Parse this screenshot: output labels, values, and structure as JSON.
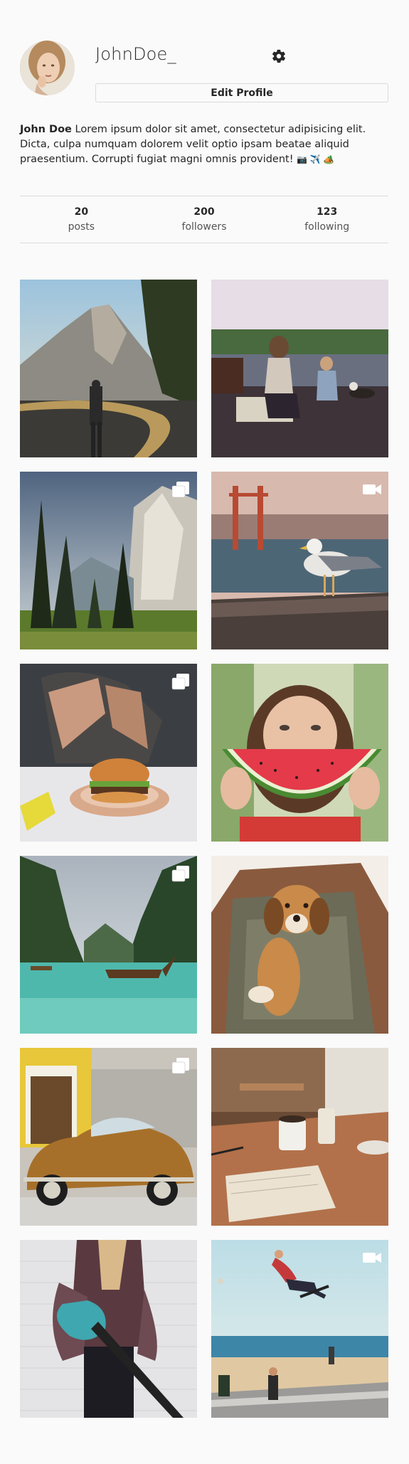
{
  "profile": {
    "username": "JohnDoe_",
    "edit_button": "Edit Profile",
    "bio_name": "John Doe",
    "bio_text": " Lorem ipsum dolor sit amet, consectetur adipisicing elit. Dicta, culpa numquam dolorem velit optio ipsam beatae aliquid praesentium. Corrupti fugiat magni omnis provident! ",
    "bio_emojis": "📷 ✈️ 🏕️",
    "avatar_icon": "profile-photo-woman"
  },
  "icons": {
    "settings": "gear-icon",
    "multiple": "multiple-images-icon",
    "video": "video-icon"
  },
  "stats": [
    {
      "count": "20",
      "label": "posts"
    },
    {
      "count": "200",
      "label": "followers"
    },
    {
      "count": "123",
      "label": "following"
    }
  ],
  "posts": [
    {
      "subject": "mountain-road-hiker",
      "type": "photo"
    },
    {
      "subject": "mother-child-dog-lake",
      "type": "photo"
    },
    {
      "subject": "forest-cliff-valley",
      "type": "multiple"
    },
    {
      "subject": "seagull-golden-gate",
      "type": "video"
    },
    {
      "subject": "burger-on-plate",
      "type": "multiple"
    },
    {
      "subject": "woman-watermelon",
      "type": "photo"
    },
    {
      "subject": "longtail-boat-lagoon",
      "type": "multiple"
    },
    {
      "subject": "puppy-in-backpack",
      "type": "photo"
    },
    {
      "subject": "vintage-beetle-car",
      "type": "multiple"
    },
    {
      "subject": "coffee-table-notebook",
      "type": "photo"
    },
    {
      "subject": "woman-with-guitar",
      "type": "photo"
    },
    {
      "subject": "skateboarder-beach",
      "type": "video"
    }
  ],
  "colors": {
    "background": "#fafafa",
    "border": "#dbdbdb",
    "text": "#262626"
  }
}
